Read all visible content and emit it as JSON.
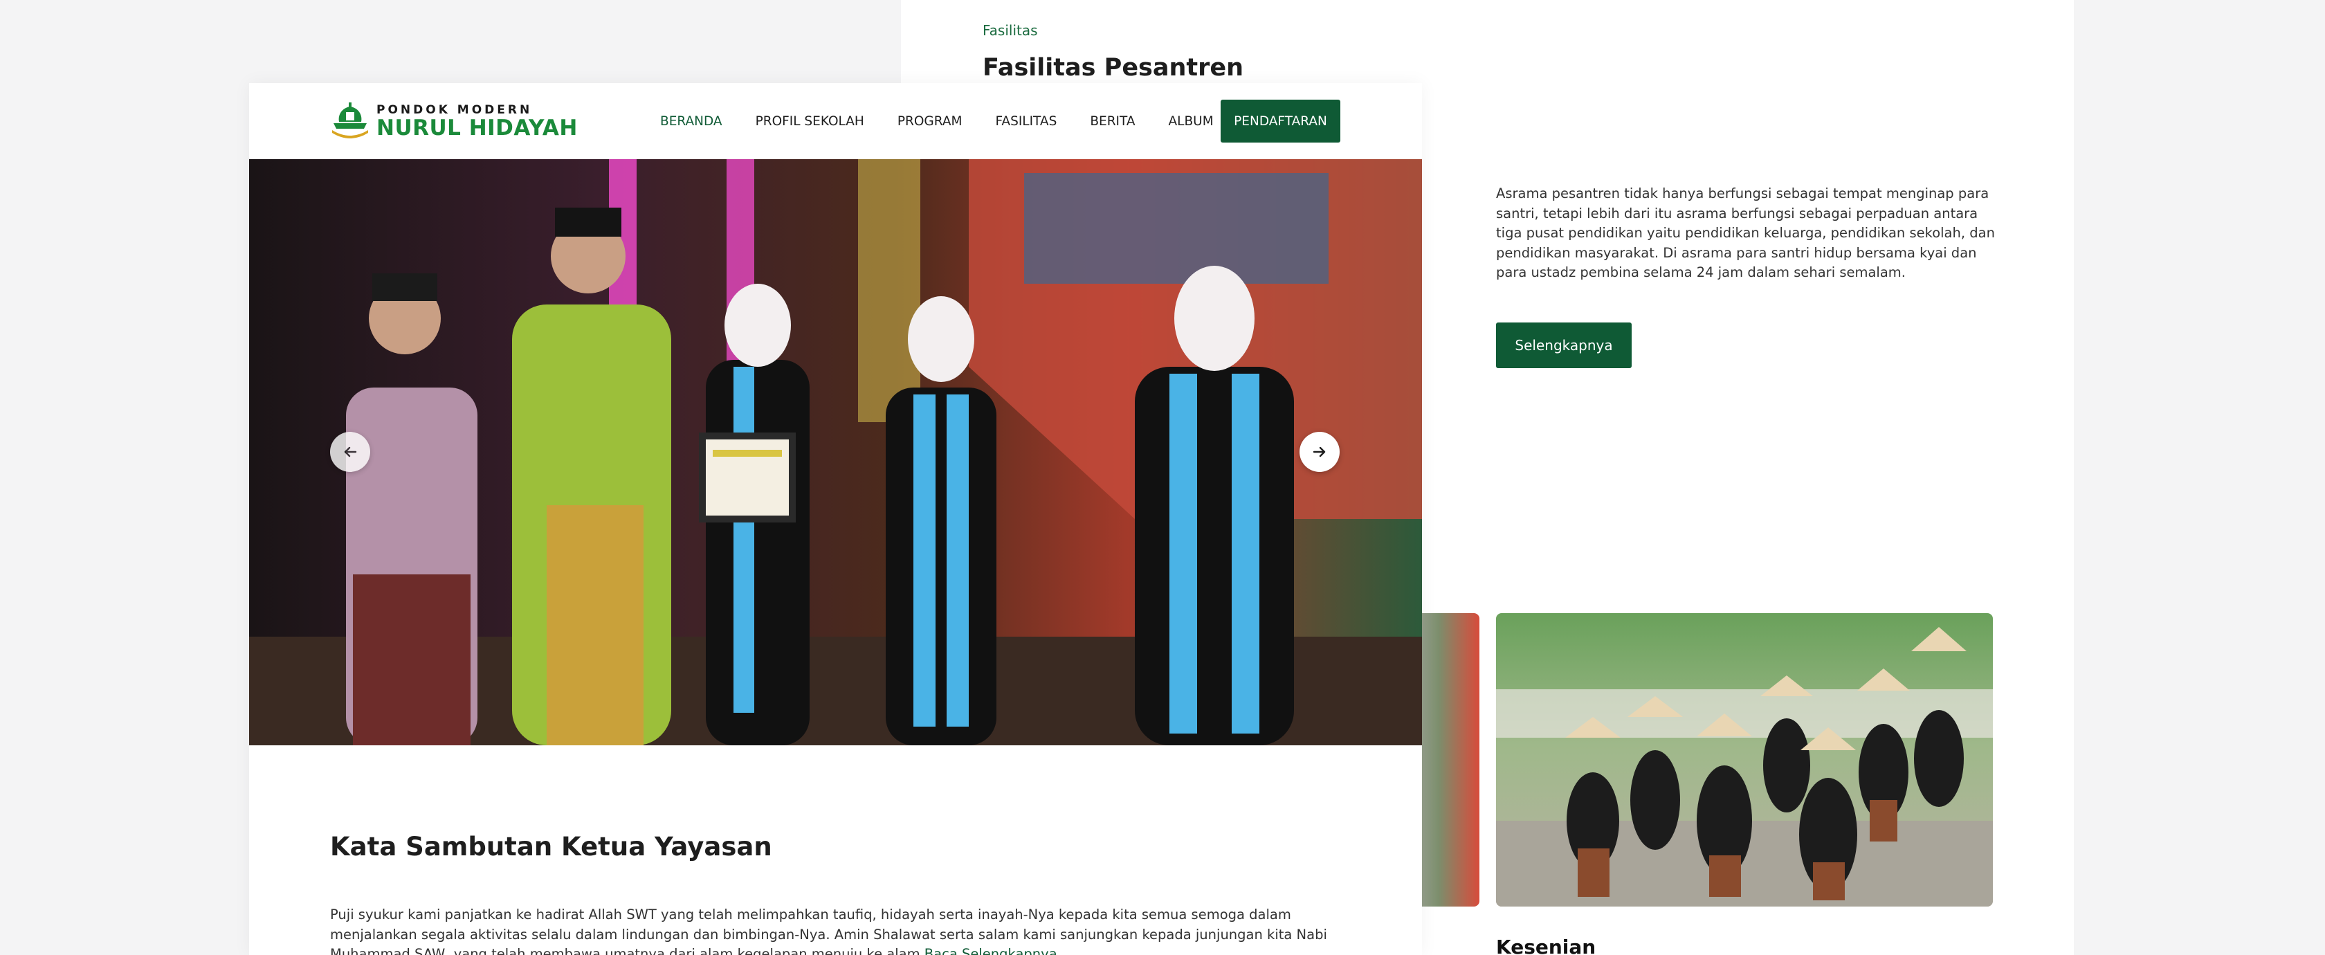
{
  "background_page": {
    "eyebrow": "Fasilitas",
    "heading": "Fasilitas Pesantren",
    "paragraph": "Asrama pesantren tidak hanya berfungsi sebagai tempat menginap para santri, tetapi lebih dari itu asrama berfungsi sebagai perpaduan antara tiga pusat pendidikan yaitu pendidikan keluarga, pendidikan sekolah, dan pendidikan masyarakat. Di asrama para santri hidup bersama kyai dan para ustadz pembina selama 24 jam dalam sehari semalam.",
    "button_label": "Selengkapnya",
    "gallery_caption": "Kesenian"
  },
  "navbar": {
    "logo_line1": "PONDOK MODERN",
    "logo_line2": "NURUL HIDAYAH",
    "items": [
      {
        "label": "BERANDA",
        "active": true
      },
      {
        "label": "PROFIL SEKOLAH",
        "active": false
      },
      {
        "label": "PROGRAM",
        "active": false
      },
      {
        "label": "FASILITAS",
        "active": false
      },
      {
        "label": "BERITA",
        "active": false
      },
      {
        "label": "ALBUM",
        "active": false
      }
    ],
    "cta_label": "PENDAFTARAN"
  },
  "hero": {
    "prev_icon": "arrow-left-icon",
    "next_icon": "arrow-right-icon"
  },
  "welcome": {
    "title": "Kata Sambutan Ketua Yayasan",
    "text": "Puji syukur kami panjatkan ke hadirat Allah SWT yang telah melimpahkan taufiq, hidayah serta inayah-Nya kepada kita semua semoga dalam menjalankan segala aktivitas selalu dalam lindungan dan bimbingan-Nya. Amin Shalawat serta salam kami sanjungkan kepada junjungan kita Nabi Muhammad SAW, yang telah membawa umatnya dari alam kegelapan menuju ke alam",
    "link_label": "Baca Selengkapnya"
  },
  "colors": {
    "brand_green": "#0f5a35",
    "logo_green": "#1b8a3a",
    "page_background": "#f4f4f5"
  }
}
